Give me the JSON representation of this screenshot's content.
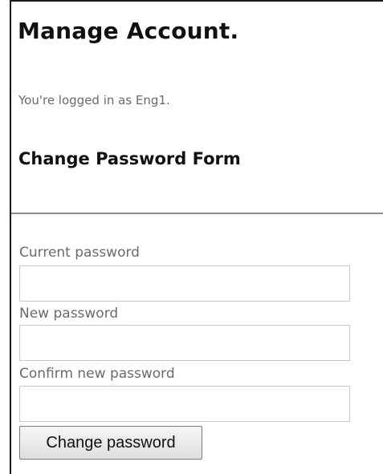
{
  "page": {
    "title": "Manage Account.",
    "logged_in_message": "You're logged in as Eng1."
  },
  "form": {
    "heading": "Change Password Form",
    "fields": [
      {
        "label": "Current password",
        "value": ""
      },
      {
        "label": "New password",
        "value": ""
      },
      {
        "label": "Confirm new password",
        "value": ""
      }
    ],
    "submit_label": "Change password"
  }
}
